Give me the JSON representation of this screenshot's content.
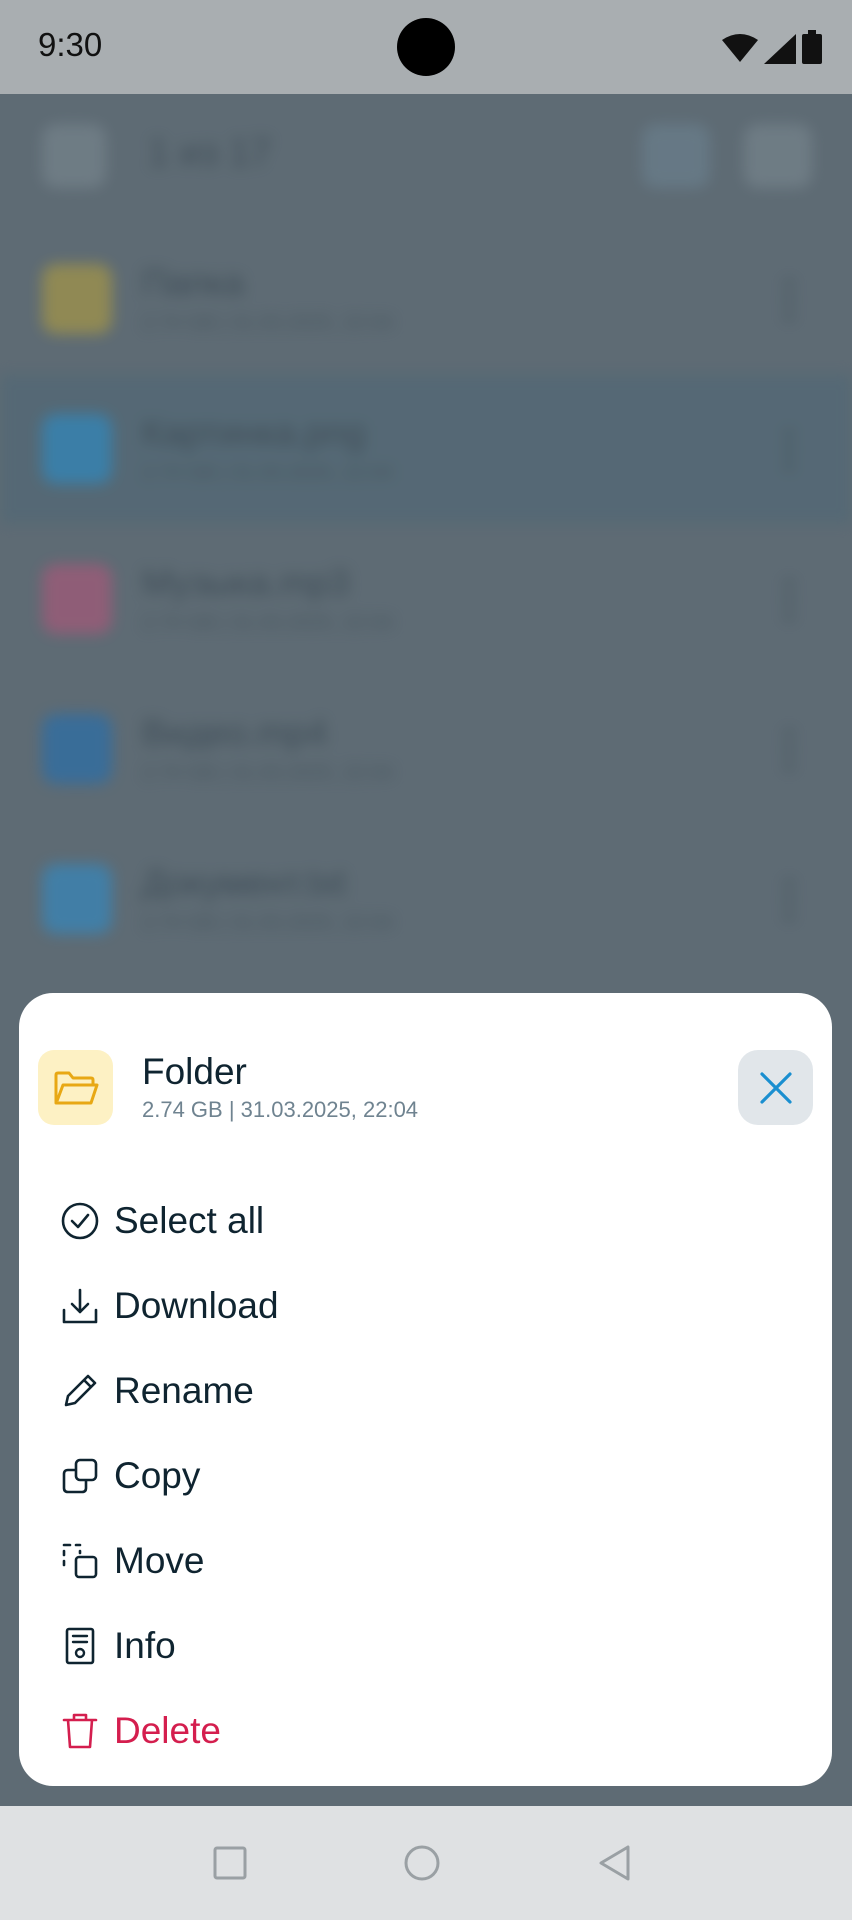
{
  "status_bar": {
    "time": "9:30"
  },
  "background": {
    "title": "1 из 17",
    "rows": [
      {
        "name": "Папка",
        "meta": "2.74 GB | 31.03.2025, 22:04",
        "color": "#b9a23a",
        "selected": false
      },
      {
        "name": "Картинка.png",
        "meta": "2.74 GB | 31.03.2025, 22:04",
        "color": "#1f8fd2",
        "selected": true
      },
      {
        "name": "Музыка.mp3",
        "meta": "2.74 GB | 31.03.2025, 22:04",
        "color": "#b8537a",
        "selected": false
      },
      {
        "name": "Видео.mp4",
        "meta": "2.74 GB | 31.03.2025, 22:04",
        "color": "#1c6fb7",
        "selected": false
      },
      {
        "name": "Документ.txt",
        "meta": "2.74 GB | 31.03.2025, 22:04",
        "color": "#2a8fd0",
        "selected": false
      }
    ]
  },
  "sheet": {
    "title": "Folder",
    "meta": "2.74 GB | 31.03.2025, 22:04",
    "thumb_icon": "folder-open-icon",
    "close_icon": "close-icon",
    "accent_color": "#1a8fd0",
    "danger_color": "#d41e4e",
    "menu": [
      {
        "label": "Select all",
        "icon": "check-circle-icon"
      },
      {
        "label": "Download",
        "icon": "download-icon"
      },
      {
        "label": "Rename",
        "icon": "pencil-icon"
      },
      {
        "label": "Copy",
        "icon": "copy-icon"
      },
      {
        "label": "Move",
        "icon": "move-icon"
      },
      {
        "label": "Info",
        "icon": "info-document-icon"
      },
      {
        "label": "Delete",
        "icon": "trash-icon"
      }
    ]
  },
  "nav_bar": {
    "buttons": [
      "recents-square-icon",
      "home-circle-icon",
      "back-triangle-icon"
    ]
  }
}
